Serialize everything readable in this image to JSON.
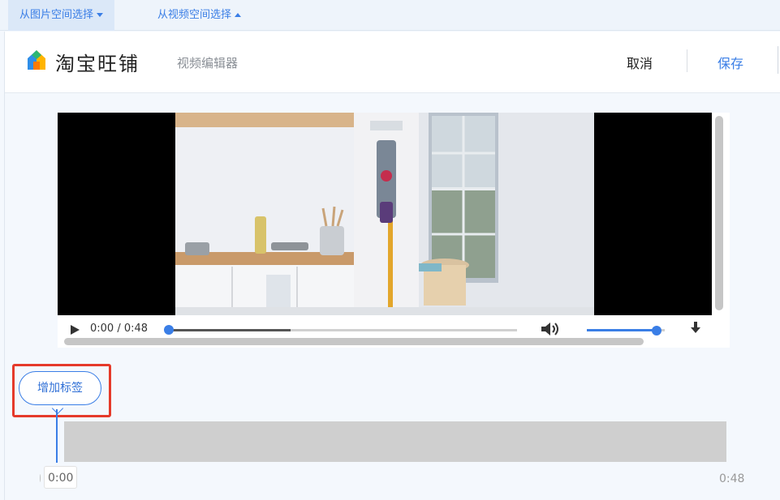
{
  "source_tabs": [
    {
      "label": "从图片空间选择",
      "caret": "down"
    },
    {
      "label": "从视频空间选择",
      "caret": "up"
    }
  ],
  "header": {
    "logo_icon": "house-logo-icon",
    "brand": "淘宝旺铺",
    "subtitle": "视频编辑器",
    "cancel_label": "取消",
    "save_label": "保存"
  },
  "player": {
    "time_readout": "0:00 / 0:48",
    "playback_progress": 0,
    "buffered_fraction": 0.35,
    "volume_level": 0.9,
    "icons": [
      "play-icon",
      "volume-icon",
      "fullscreen-icon"
    ]
  },
  "tag_button": {
    "label": "增加标签"
  },
  "timeline": {
    "start_time": "0:00",
    "end_time": "0:48"
  },
  "colors": {
    "accent": "#3a7ee6",
    "highlight": "#e53a2a",
    "timeline_track": "#cfcfcf"
  }
}
